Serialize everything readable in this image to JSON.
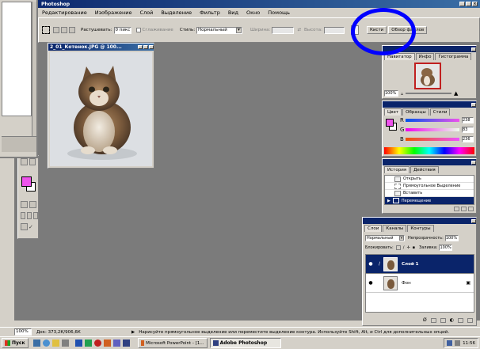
{
  "window": {
    "title": "Photoshop"
  },
  "menu": [
    "Редактирование",
    "Изображение",
    "Слой",
    "Выделение",
    "Фильтр",
    "Вид",
    "Окно",
    "Помощь"
  ],
  "options_bar": {
    "feather_label": "Растушевать:",
    "feather_value": "0 пикс",
    "antialias_label": "Сглаживание",
    "style_label": "Стиль:",
    "style_value": "Нормальный",
    "width_label": "Ширина:",
    "height_label": "Высота:",
    "brushes_tab": "Кисти",
    "file_browser_tab": "Обзор файлов"
  },
  "document": {
    "title": "2_01_Котенок.JPG @ 100..."
  },
  "navigator": {
    "tabs": [
      "Навигатор",
      "Инфо",
      "Гистограмма"
    ],
    "zoom": "100%"
  },
  "color_panel": {
    "tabs": [
      "Цвет",
      "Образцы",
      "Стили"
    ],
    "r_label": "R",
    "g_label": "G",
    "b_label": "B",
    "r": "238",
    "g": "83",
    "b": "236"
  },
  "history": {
    "tabs": [
      "История",
      "Действия"
    ],
    "items": [
      "Открыть",
      "Прямоугольное Выделение",
      "Вставить",
      "Перемещение"
    ]
  },
  "layers": {
    "tabs": [
      "Слои",
      "Каналы",
      "Контуры"
    ],
    "blend_mode": "Нормальный",
    "opacity_label": "Непрозрачность:",
    "opacity": "100%",
    "lock_label": "Блокировать:",
    "fill_label": "Заливка:",
    "fill": "100%",
    "items": [
      {
        "name": "Слой 1",
        "selected": true
      },
      {
        "name": "Фон",
        "selected": false
      }
    ]
  },
  "status_bar": {
    "zoom": "100%",
    "doc_info": "Док: 373,2К/906,6К",
    "hint": "Нарисуйте прямоугольное выделение или переместите выделение контура. Используйте Shift, Alt, и Ctrl для дополнительных опций."
  },
  "taskbar": {
    "start_label": "Пуск",
    "tasks": [
      "Microsoft PowerPoint - [1...",
      "Adobe Photoshop"
    ],
    "clock": "11:56"
  },
  "colors": {
    "canvas_bg": "#7b7b7b",
    "highlight_circle": "#0000ff",
    "foreground_swatch": "#ee53ec",
    "selection": "#0a246a"
  }
}
